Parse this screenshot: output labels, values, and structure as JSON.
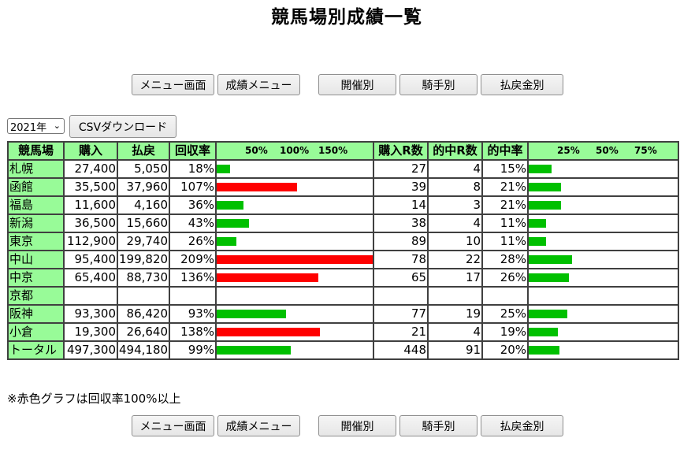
{
  "title": "競馬場別成績一覧",
  "nav": {
    "menu": "メニュー画面",
    "results_menu": "成績メニュー",
    "by_meeting": "開催別",
    "by_jockey": "騎手別",
    "by_payout": "払戻金別"
  },
  "year_select": {
    "selected": "2021年"
  },
  "csv_button": "CSVダウンロード",
  "table": {
    "headers": {
      "venue": "競馬場",
      "purchase": "購入",
      "payout": "払戻",
      "recovery_rate": "回収率",
      "recovery_scale": [
        "50%",
        "100%",
        "150%"
      ],
      "races_bought": "購入R数",
      "races_hit": "的中R数",
      "hit_rate": "的中率",
      "hit_scale": [
        "25%",
        "50%",
        "75%"
      ]
    },
    "rows": [
      {
        "venue": "札幌",
        "purchase": "27,400",
        "payout": "5,050",
        "recovery": "18%",
        "recovery_value": 18,
        "races": "27",
        "hits": "4",
        "hit_rate": "15%",
        "hit_value": 15
      },
      {
        "venue": "函館",
        "purchase": "35,500",
        "payout": "37,960",
        "recovery": "107%",
        "recovery_value": 107,
        "races": "39",
        "hits": "8",
        "hit_rate": "21%",
        "hit_value": 21
      },
      {
        "venue": "福島",
        "purchase": "11,600",
        "payout": "4,160",
        "recovery": "36%",
        "recovery_value": 36,
        "races": "14",
        "hits": "3",
        "hit_rate": "21%",
        "hit_value": 21
      },
      {
        "venue": "新潟",
        "purchase": "36,500",
        "payout": "15,660",
        "recovery": "43%",
        "recovery_value": 43,
        "races": "38",
        "hits": "4",
        "hit_rate": "11%",
        "hit_value": 11
      },
      {
        "venue": "東京",
        "purchase": "112,900",
        "payout": "29,740",
        "recovery": "26%",
        "recovery_value": 26,
        "races": "89",
        "hits": "10",
        "hit_rate": "11%",
        "hit_value": 11
      },
      {
        "venue": "中山",
        "purchase": "95,400",
        "payout": "199,820",
        "recovery": "209%",
        "recovery_value": 209,
        "races": "78",
        "hits": "22",
        "hit_rate": "28%",
        "hit_value": 28
      },
      {
        "venue": "中京",
        "purchase": "65,400",
        "payout": "88,730",
        "recovery": "136%",
        "recovery_value": 136,
        "races": "65",
        "hits": "17",
        "hit_rate": "26%",
        "hit_value": 26
      },
      {
        "venue": "京都",
        "purchase": "",
        "payout": "",
        "recovery": "",
        "recovery_value": null,
        "races": "",
        "hits": "",
        "hit_rate": "",
        "hit_value": null
      },
      {
        "venue": "阪神",
        "purchase": "93,300",
        "payout": "86,420",
        "recovery": "93%",
        "recovery_value": 93,
        "races": "77",
        "hits": "19",
        "hit_rate": "25%",
        "hit_value": 25
      },
      {
        "venue": "小倉",
        "purchase": "19,300",
        "payout": "26,640",
        "recovery": "138%",
        "recovery_value": 138,
        "races": "21",
        "hits": "4",
        "hit_rate": "19%",
        "hit_value": 19
      },
      {
        "venue": "トータル",
        "purchase": "497,300",
        "payout": "494,180",
        "recovery": "99%",
        "recovery_value": 99,
        "races": "448",
        "hits": "91",
        "hit_rate": "20%",
        "hit_value": 20
      }
    ]
  },
  "note": "※赤色グラフは回収率100%以上",
  "colors": {
    "header_bg": "#98fb98",
    "bar_green": "#00c000",
    "bar_red": "#ff0000"
  }
}
